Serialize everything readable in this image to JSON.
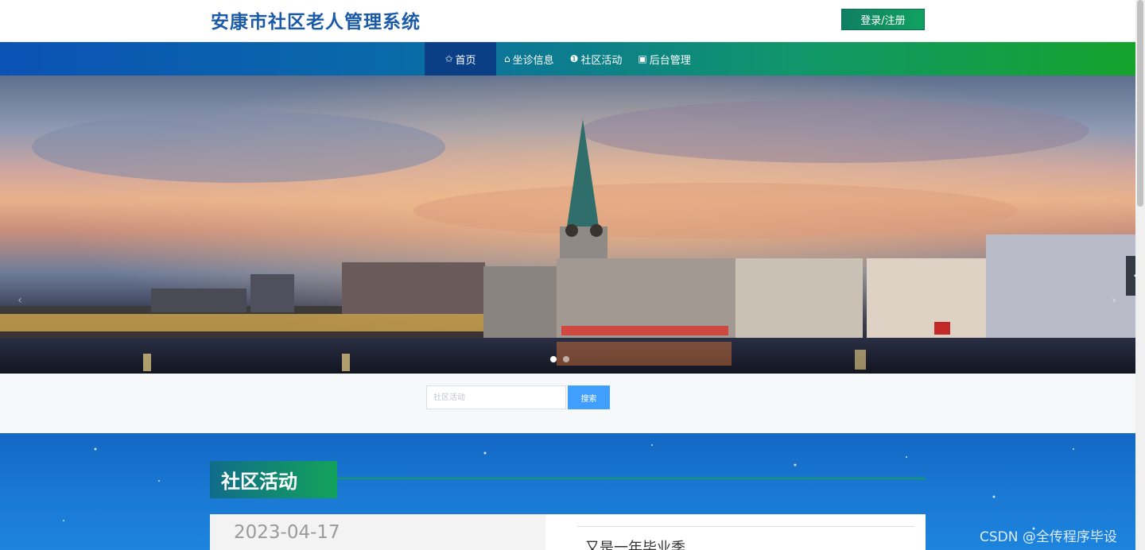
{
  "header": {
    "title": "安康市社区老人管理系统",
    "login_label": "登录/注册"
  },
  "nav": {
    "items": [
      {
        "icon": "star-icon",
        "glyph": "✩",
        "label": "首页"
      },
      {
        "icon": "bag-icon",
        "glyph": "⌂",
        "label": "坐诊信息"
      },
      {
        "icon": "info-icon",
        "glyph": "❶",
        "label": "社区活动"
      },
      {
        "icon": "clipboard-icon",
        "glyph": "▣",
        "label": "后台管理"
      }
    ]
  },
  "banner": {
    "prev_glyph": "‹",
    "next_glyph": "›",
    "side_glyph": "‹",
    "slide_count": 2,
    "active_slide": 1
  },
  "search": {
    "placeholder": "社区活动",
    "button_label": "搜索"
  },
  "section": {
    "title": "社区活动",
    "card": {
      "date": "2023-04-17",
      "title": "又是一年毕业季"
    }
  },
  "watermark": "CSDN @全传程序毕设",
  "colors": {
    "brand_blue": "#1b5aa6",
    "brand_green": "#11a15f",
    "nav_active": "#0a3f86",
    "search_button": "#409eff"
  }
}
